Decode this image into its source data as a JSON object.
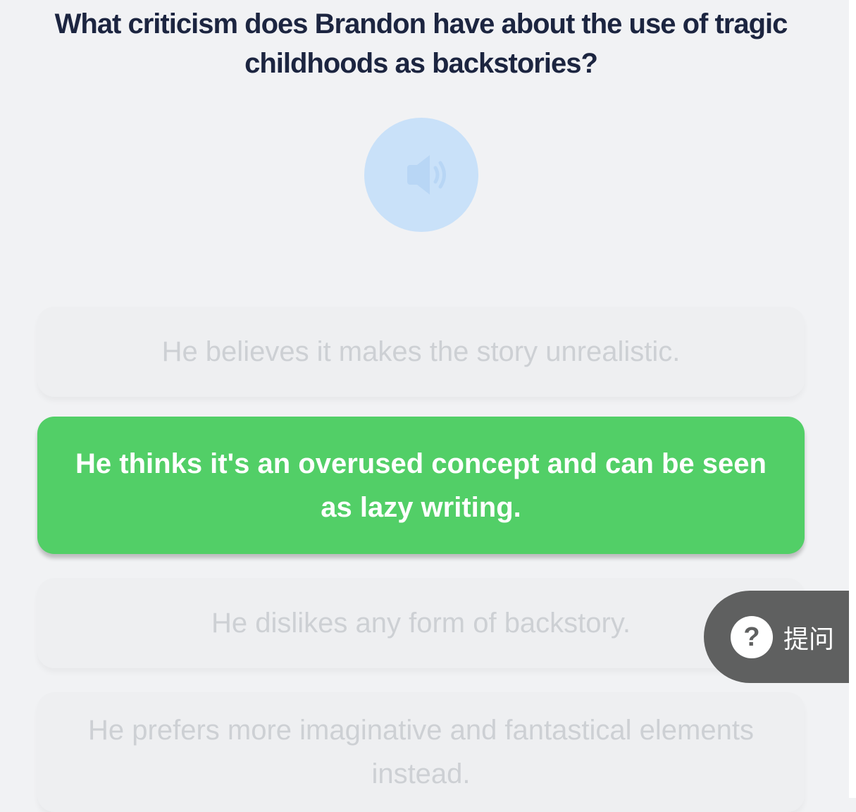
{
  "quiz": {
    "question": "What criticism does Brandon have about the use of tragic childhoods as backstories?",
    "options": [
      {
        "label": "He believes it makes the story unrealistic.",
        "state": "dimmed"
      },
      {
        "label": "He thinks it's an overused concept and can be seen as lazy writing.",
        "state": "selected"
      },
      {
        "label": "He dislikes any form of backstory.",
        "state": "dimmed"
      },
      {
        "label": "He prefers more imaginative and fantastical elements instead.",
        "state": "dimmed"
      }
    ]
  },
  "audio": {
    "icon": "speaker-icon"
  },
  "ask_button": {
    "icon_text": "?",
    "label": "提问"
  },
  "colors": {
    "background": "#f1f2f4",
    "question_text": "#1c2540",
    "selected_option": "#52cf67",
    "dimmed_option": "#eeeff1",
    "dimmed_text": "#cdd0d4",
    "audio_button": "#c9e1f9",
    "ask_button": "#5f6060"
  }
}
